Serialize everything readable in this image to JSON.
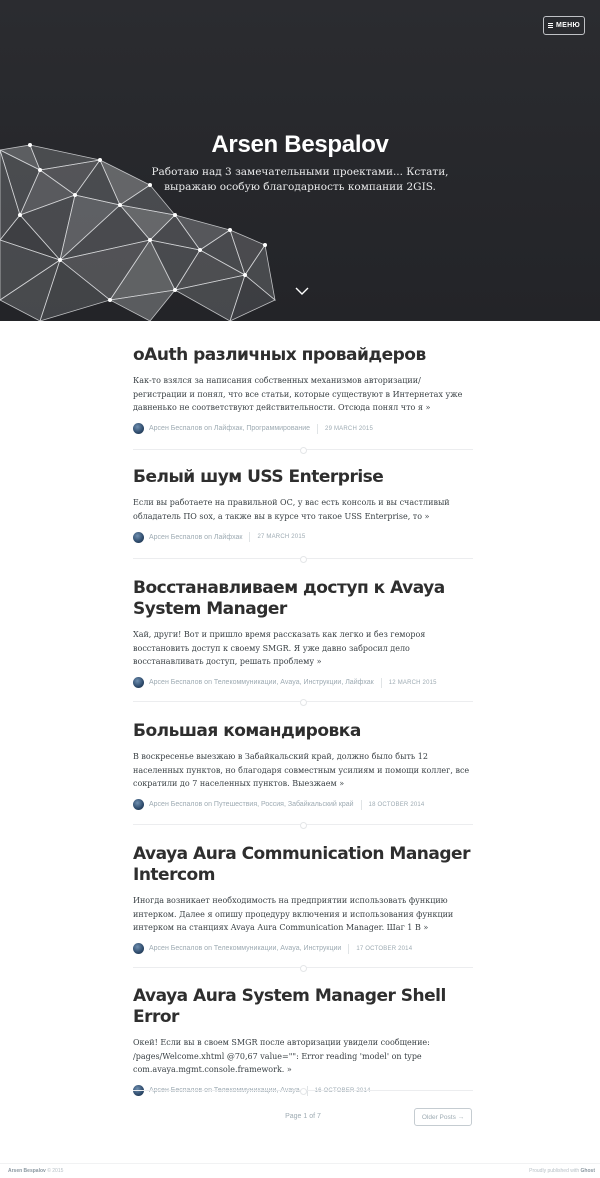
{
  "header": {
    "menu_label": "МЕНЮ",
    "title": "Arsen Bespalov",
    "description": "Работаю над 3 замечательными проектами... Кстати, выражаю особую благодарность компании 2GIS."
  },
  "posts": [
    {
      "title": "oAuth различных провайдеров",
      "excerpt": "Как-то взялся за написания собственных механизмов авторизации/регистрации и понял, что все статьи, которые существуют в Интернетах уже давненько не соответствуют действительности. Отсюда понял что я »",
      "author": "Арсен Беспалов",
      "tags": "Лайфхак, Программирование",
      "date": "29 MARCH 2015"
    },
    {
      "title": "Белый шум USS Enterprise",
      "excerpt": "Если вы работаете на правильной ОС, у вас есть консоль и вы счастливый обладатель ПО sox, а также вы в курсе что такое USS Enterprise, то »",
      "author": "Арсен Беспалов",
      "tags": "Лайфхак",
      "date": "27 MARCH 2015"
    },
    {
      "title": "Восстанавливаем доступ к Avaya System Manager",
      "excerpt": "Хай, други! Вот и пришло время рассказать как легко и без гемороя восстановить доступ к своему SMGR. Я уже давно забросил дело восстанавливать доступ, решать проблему »",
      "author": "Арсен Беспалов",
      "tags": "Телекоммуникации, Avaya, Инструкции, Лайфхак",
      "date": "12 MARCH 2015"
    },
    {
      "title": "Большая командировка",
      "excerpt": "В воскресенье выезжаю в Забайкальский край, должно было быть 12 населенных пунктов, но благодаря совместным усилиям и помощи коллег, все сократили до 7 населенных пунктов. Выезжаем »",
      "author": "Арсен Беспалов",
      "tags": "Путешествия, Россия, Забайкальский край",
      "date": "18 OCTOBER 2014"
    },
    {
      "title": "Avaya Aura Communication Manager Intercom",
      "excerpt": "Иногда возникает необходимость на предприятии использовать функцию интерком. Далее я опишу процедуру включения и использования функции интерком на станциях Avaya Aura Communication Manager. Шаг 1 В »",
      "author": "Арсен Беспалов",
      "tags": "Телекоммуникации, Avaya, Инструкции",
      "date": "17 OCTOBER 2014"
    },
    {
      "title": "Avaya Aura System Manager Shell Error",
      "excerpt": "Окей! Если вы в своем SMGR после авторизации увидели сообщение: /pages/Welcome.xhtml @70,67 value=\"\": Error reading 'model' on type com.avaya.mgmt.console.framework. »",
      "author": "Арсен Беспалов",
      "tags": "Телекоммуникации, Avaya",
      "date": "16 OCTOBER 2014"
    }
  ],
  "meta_on": "on",
  "pagination": {
    "page_label": "Page 1 of 7",
    "older_label": "Older Posts →"
  },
  "footer": {
    "site_name": "Arsen Bespalov",
    "copyright": "© 2015",
    "proudly": "Proudly published with",
    "platform": "Ghost"
  }
}
